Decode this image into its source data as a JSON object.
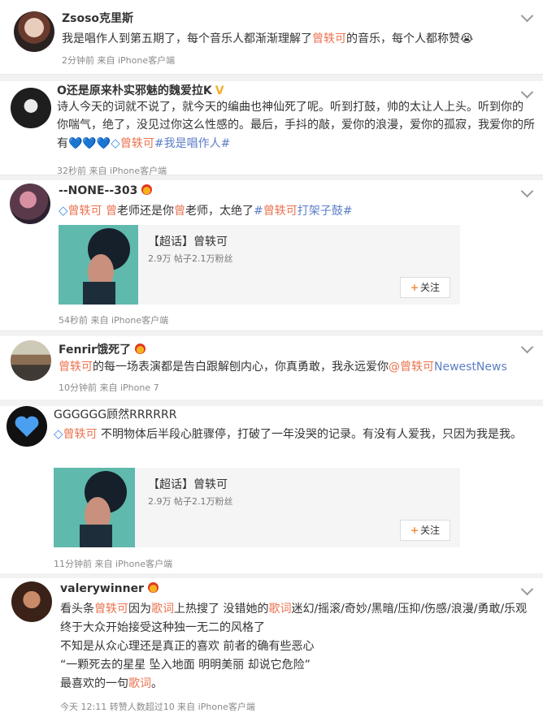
{
  "comments": [
    {
      "username": "Zsoso克里斯",
      "body_a": "我是唱作人到第五期了，每个音乐人都渐渐理解了",
      "mention": "曾轶可",
      "body_b": "的音乐，每个人都称赞",
      "emoji": "😭",
      "meta": "2分钟前 来自 iPhone客户端"
    },
    {
      "username": "O还是原来朴实邪魅的魏爱拉K",
      "line1": "诗人今天的词就不说了，就今天的编曲也神仙死了呢。听到打鼓，帅的太让人上头。听到你的",
      "line2": "你喘气，绝了，没见过你这么性感的。最后，手抖的敲，爱你的浪漫，爱你的孤寂，我爱你的所",
      "line3_a": "有💙💙💙",
      "link": "曾轶可",
      "hashtag": "#我是唱作人#",
      "meta": "32秒前 来自 iPhone客户端"
    },
    {
      "username": "--NONE--303",
      "link": "曾轶可",
      "body_a": " 曾",
      "body_b": "老师还是你",
      "body_c": "曾",
      "body_d": "老师，太绝了",
      "hashtag_a": "#",
      "hashtag_link": "曾轶可",
      "hashtag_b": "打架子鼓#",
      "card": {
        "title": "【超话】曾轶可",
        "stats": "2.9万 帖子2.1万粉丝",
        "follow": "关注"
      },
      "meta": "54秒前 来自 iPhone客户端"
    },
    {
      "username": "Fenrir饿死了",
      "link": "曾轶可",
      "body": "的每一场表演都是告白跟解刨内心，你真勇敢，我永远爱你",
      "mention": "@曾轶可",
      "extra": "NewestNews",
      "meta": "10分钟前 来自 iPhone 7"
    },
    {
      "username": "GGGGGG顾然RRRRRR",
      "link": "曾轶可",
      "body": " 不明物体后半段心脏骤停，打破了一年没哭的记录。有没有人爱我，只因为我是我。",
      "card": {
        "title": "【超话】曾轶可",
        "stats": "2.9万 帖子2.1万粉丝",
        "follow": "关注"
      },
      "meta": "11分钟前 来自 iPhone客户端"
    },
    {
      "username": "valerywinner",
      "l1_a": "看头条",
      "l1_link": "曾轶可",
      "l1_b": "因为",
      "l1_hl": "歌词",
      "l1_c": "上热搜了 没错她的",
      "l1_hl2": "歌词",
      "l1_d": "迷幻/摇滚/奇妙/黑暗/压抑/伤感/浪漫/勇敢/乐观",
      "l2": "终于大众开始接受这种独一无二的风格了",
      "l3": "不知是从众心理还是真正的喜欢 前者的确有些恶心",
      "l4": "“一颗死去的星星 坠入地面 明明美丽 却说它危险”",
      "l5_a": "最喜欢的一句",
      "l5_hl": "歌词",
      "l5_b": "。",
      "meta": "今天 12:11 转赞人数超过10 来自 iPhone客户端"
    }
  ],
  "colors": {
    "link": "#eb7350",
    "hashtag": "#5c7ec7",
    "meta": "#8a8a8a"
  }
}
